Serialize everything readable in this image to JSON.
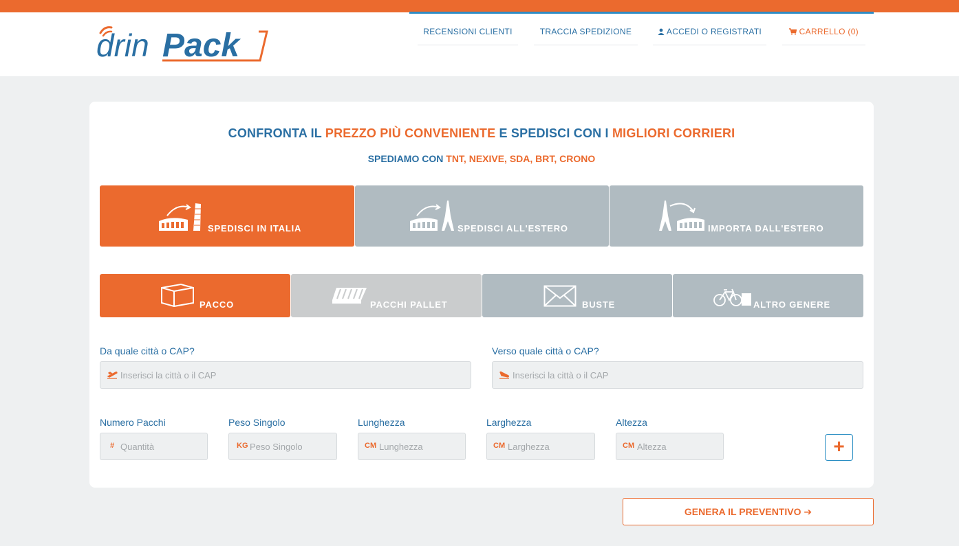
{
  "logo": {
    "text_left": "drin",
    "text_right": "Pack"
  },
  "nav": [
    {
      "id": "reviews",
      "label": "RECENSIONI CLIENTI"
    },
    {
      "id": "track",
      "label": "TRACCIA SPEDIZIONE"
    },
    {
      "id": "login",
      "label": "ACCEDI O REGISTRATI",
      "icon": "user-icon"
    },
    {
      "id": "cart",
      "label": "CARRELLO (0)",
      "icon": "cart-icon"
    }
  ],
  "headline": {
    "part1": "CONFRONTA IL ",
    "part2": "PREZZO PIÙ CONVENIENTE",
    "part3": " E SPEDISCI CON I ",
    "part4": "MIGLIORI CORRIERI"
  },
  "subline": {
    "part1": "SPEDIAMO CON ",
    "part2": "TNT, NEXIVE, SDA, BRT, CRONO"
  },
  "service_tabs": [
    {
      "label": "SPEDISCI IN ITALIA",
      "icon": "colosseum-pisa-icon",
      "active": true
    },
    {
      "label": "SPEDISCI ALL'ESTERO",
      "icon": "colosseum-eiffel-icon",
      "active": false
    },
    {
      "label": "IMPORTA DALL'ESTERO",
      "icon": "eiffel-colosseum-icon",
      "active": false
    }
  ],
  "package_tabs": [
    {
      "label": "PACCO",
      "icon": "box-icon",
      "active": true
    },
    {
      "label": "PACCHI PALLET",
      "icon": "pallet-icon",
      "active": false
    },
    {
      "label": "BUSTE",
      "icon": "envelope-icon",
      "active": false
    },
    {
      "label": "ALTRO GENERE",
      "icon": "bicycle-icon",
      "active": false
    }
  ],
  "origin": {
    "label": "Da quale città o CAP?",
    "placeholder": "Inserisci la città o il CAP",
    "icon": "plane-takeoff-icon"
  },
  "destination": {
    "label": "Verso quale città o CAP?",
    "placeholder": "Inserisci la città o il CAP",
    "icon": "plane-landing-icon"
  },
  "dimensions": [
    {
      "label": "Numero Pacchi",
      "prefix": "#",
      "placeholder": "Quantità"
    },
    {
      "label": "Peso Singolo",
      "prefix": "KG",
      "placeholder": "Peso Singolo"
    },
    {
      "label": "Lunghezza",
      "prefix": "CM",
      "placeholder": "Lunghezza"
    },
    {
      "label": "Larghezza",
      "prefix": "CM",
      "placeholder": "Larghezza"
    },
    {
      "label": "Altezza",
      "prefix": "CM",
      "placeholder": "Altezza"
    }
  ],
  "add_button": {
    "label": "+"
  },
  "cta": {
    "label": "GENERA IL PREVENTIVO ➔"
  },
  "colors": {
    "orange": "#eb6a2e",
    "blue": "#2a6fa3",
    "gray_tile": "#b0bbc1",
    "background": "#eef0f1"
  }
}
